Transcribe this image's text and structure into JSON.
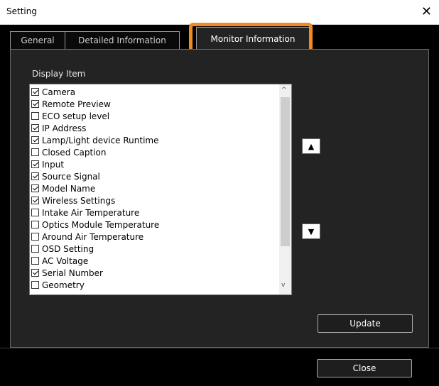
{
  "window": {
    "title": "Setting",
    "close_glyph": "✕"
  },
  "tabs": [
    {
      "label": "General",
      "active": false
    },
    {
      "label": "Detailed Information",
      "active": false
    },
    {
      "label": "Monitor Information",
      "active": true
    }
  ],
  "highlight_color": "#f28a23",
  "panel": {
    "display_item_label": "Display Item",
    "items": [
      {
        "label": "Camera",
        "checked": true
      },
      {
        "label": "Remote Preview",
        "checked": true
      },
      {
        "label": "ECO setup level",
        "checked": false
      },
      {
        "label": "IP Address",
        "checked": true
      },
      {
        "label": "Lamp/Light device Runtime",
        "checked": true
      },
      {
        "label": "Closed Caption",
        "checked": false
      },
      {
        "label": "Input",
        "checked": true
      },
      {
        "label": "Source Signal",
        "checked": true
      },
      {
        "label": "Model Name",
        "checked": true
      },
      {
        "label": "Wireless Settings",
        "checked": true
      },
      {
        "label": "Intake Air Temperature",
        "checked": false
      },
      {
        "label": "Optics Module Temperature",
        "checked": false
      },
      {
        "label": "Around Air Temperature",
        "checked": false
      },
      {
        "label": "OSD Setting",
        "checked": false
      },
      {
        "label": "AC Voltage",
        "checked": false
      },
      {
        "label": "Serial Number",
        "checked": true
      },
      {
        "label": "Geometry",
        "checked": false
      }
    ],
    "move_up_glyph": "▲",
    "move_down_glyph": "▼",
    "scroll_up_glyph": "^",
    "scroll_down_glyph": "v",
    "update_label": "Update"
  },
  "footer": {
    "close_label": "Close"
  }
}
